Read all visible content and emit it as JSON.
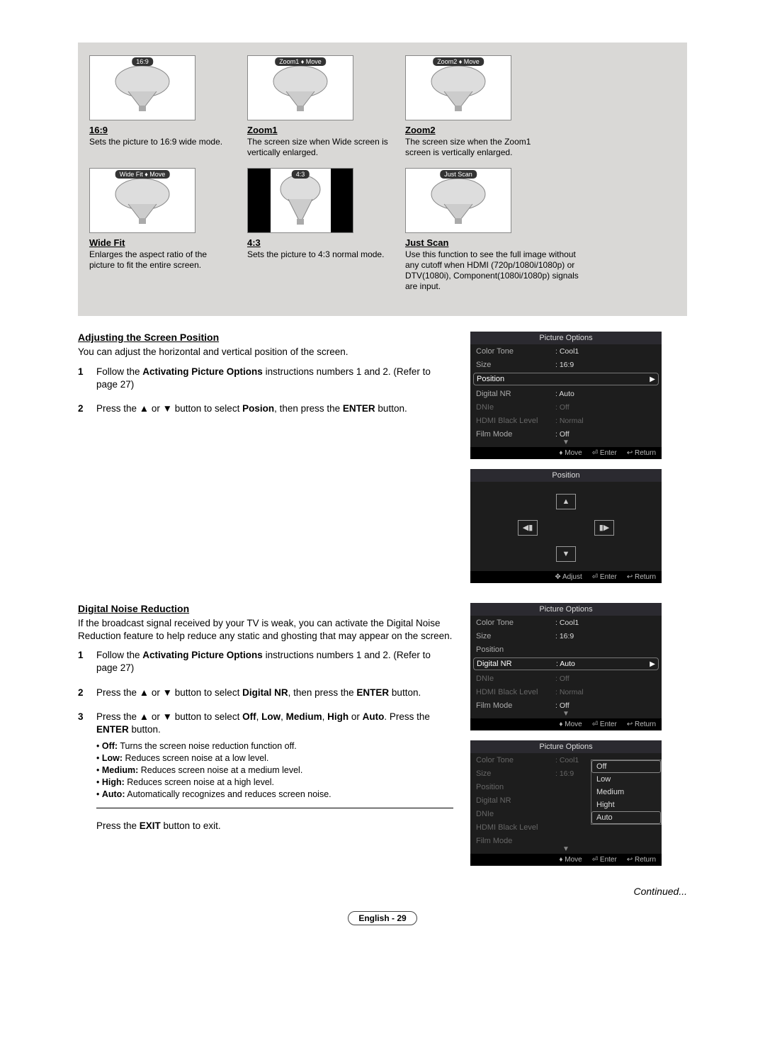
{
  "sizes": [
    {
      "badge": "16:9",
      "title": "16:9",
      "desc": "Sets the picture to 16:9 wide mode.",
      "pillar": false
    },
    {
      "badge": "Zoom1 ♦ Move",
      "title": "Zoom1",
      "desc": "The screen size when Wide screen is vertically enlarged.",
      "pillar": false
    },
    {
      "badge": "Zoom2 ♦ Move",
      "title": "Zoom2",
      "desc": "The screen size when the Zoom1 screen is vertically enlarged.",
      "pillar": false
    },
    {
      "badge": "Wide Fit ♦ Move",
      "title": "Wide Fit",
      "desc": "Enlarges the aspect ratio of the picture to fit the entire screen.",
      "pillar": false
    },
    {
      "badge": "4:3",
      "title": "4:3",
      "desc": "Sets the picture to 4:3 normal mode.",
      "pillar": true
    },
    {
      "badge": "Just Scan",
      "title": "Just Scan",
      "desc": "Use this function to see the full image without any cutoff when HDMI (720p/1080i/1080p) or DTV(1080i), Component(1080i/1080p) signals are input.",
      "pillar": false
    }
  ],
  "section1": {
    "heading": "Adjusting the Screen Position",
    "intro": "You can adjust the horizontal and vertical position of the screen.",
    "steps": [
      "Follow the <b>Activating Picture Options</b> instructions numbers 1 and 2. (Refer to page 27)",
      "Press the ▲ or ▼ button to select <b>Posion</b>, then press the <b>ENTER</b> button."
    ]
  },
  "section2": {
    "heading": "Digital Noise Reduction",
    "intro": "If the broadcast signal received by your TV is weak, you can activate the Digital Noise Reduction feature to help reduce any static and ghosting that may appear on the screen.",
    "steps": [
      "Follow the <b>Activating Picture Options</b> instructions numbers 1 and 2. (Refer to page 27)",
      "Press the ▲ or ▼ button to select <b>Digital NR</b>, then press the <b>ENTER</b> button.",
      "Press the ▲ or ▼ button to select <b>Off</b>, <b>Low</b>, <b>Medium</b>, <b>High</b> or <b>Auto</b>. Press the <b>ENTER</b> button."
    ],
    "bullets": [
      "<b>Off:</b> Turns the screen noise reduction function off.",
      "<b>Low:</b> Reduces screen noise at a low level.",
      "<b>Medium:</b> Reduces screen noise at a medium level.",
      "<b>High:</b> Reduces screen noise at a high level.",
      "<b>Auto:</b> Automatically recognizes and reduces screen noise."
    ],
    "exit": "Press the <b>EXIT</b> button to exit."
  },
  "osd": {
    "title": "Picture Options",
    "rows": [
      {
        "lbl": "Color Tone",
        "val": ": Cool1"
      },
      {
        "lbl": "Size",
        "val": ": 16:9"
      },
      {
        "lbl": "Position",
        "val": ""
      },
      {
        "lbl": "Digital NR",
        "val": ": Auto"
      },
      {
        "lbl": "DNIe",
        "val": ": Off"
      },
      {
        "lbl": "HDMI Black Level",
        "val": ": Normal"
      },
      {
        "lbl": "Film Mode",
        "val": ": Off"
      }
    ],
    "foot_move": "Move",
    "foot_adjust": "Adjust",
    "foot_enter": "Enter",
    "foot_return": "Return",
    "position_title": "Position",
    "submenu": [
      "Off",
      "Low",
      "Medium",
      "Hight",
      "Auto"
    ]
  },
  "continued": "Continued...",
  "footer": "English - 29"
}
